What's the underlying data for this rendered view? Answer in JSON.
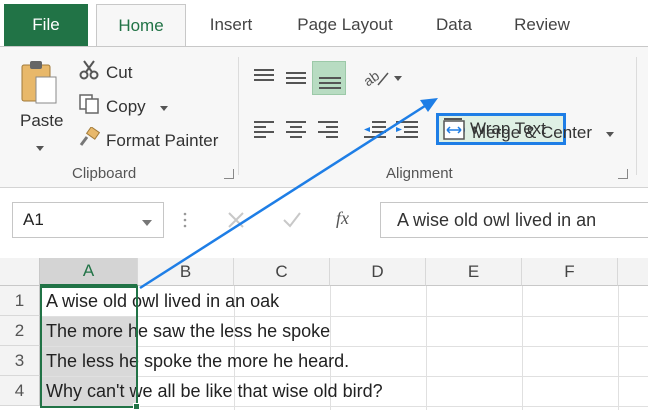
{
  "tabs": [
    {
      "label": "File"
    },
    {
      "label": "Home"
    },
    {
      "label": "Insert"
    },
    {
      "label": "Page Layout"
    },
    {
      "label": "Data"
    },
    {
      "label": "Review"
    }
  ],
  "clipboard": {
    "paste_label": "Paste",
    "cut_label": "Cut",
    "copy_label": "Copy",
    "format_painter_label": "Format Painter",
    "group_label": "Clipboard"
  },
  "alignment": {
    "wrap_text_label": "Wrap Text",
    "merge_center_label": "Merge & Center",
    "group_label": "Alignment"
  },
  "formula_bar": {
    "name_box": "A1",
    "fx_label": "fx",
    "content": "A wise old owl lived in an"
  },
  "columns": [
    "A",
    "B",
    "C",
    "D",
    "E",
    "F"
  ],
  "rows": [
    {
      "num": "1",
      "text": "A wise old owl lived in an oak"
    },
    {
      "num": "2",
      "text": "The more he saw the less he spoke"
    },
    {
      "num": "3",
      "text": "The less he spoke the more he heard."
    },
    {
      "num": "4",
      "text": "Why can't we all be like that wise old bird?"
    }
  ],
  "colors": {
    "excel_green": "#217346",
    "highlight_blue": "#1e7ee6"
  }
}
